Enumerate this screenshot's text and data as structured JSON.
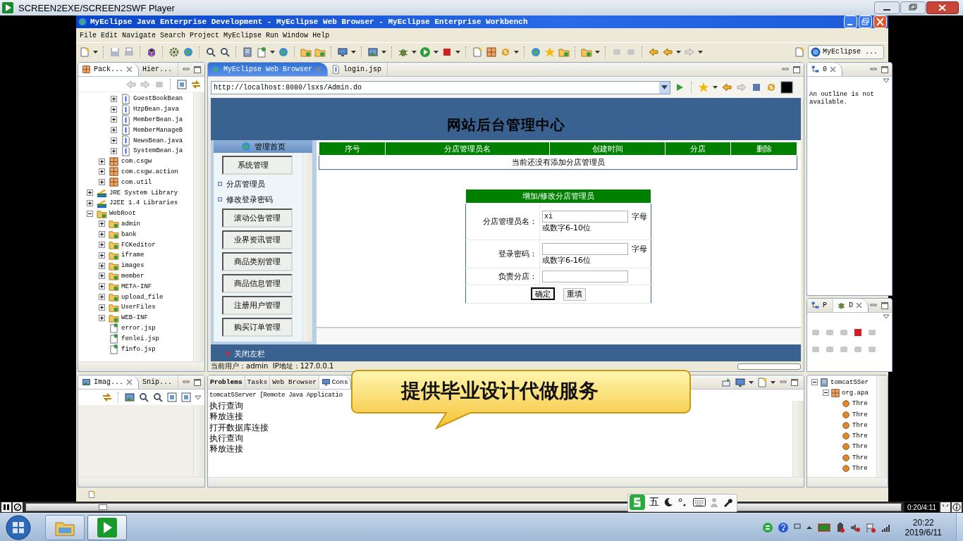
{
  "player": {
    "title": "SCREEN2EXE/SCREEN2SWF Player",
    "time": "0:20/4:11",
    "seek": {
      "level": 0.088
    }
  },
  "window": {
    "title": "MyEclipse Java Enterprise Development - MyEclipse Web Browser - MyEclipse Enterprise Workbench"
  },
  "menu": [
    "File",
    "Edit",
    "Navigate",
    "Search",
    "Project",
    "MyEclipse",
    "Run",
    "Window",
    "Help"
  ],
  "perspective": "MyEclipse ...",
  "left_tabs": [
    {
      "label": "Pack...",
      "selected": true
    },
    {
      "label": "Hier...",
      "selected": false
    }
  ],
  "tree": [
    {
      "children": [
        {
          "children": [
            {
              "label": "GuestBookBean",
              "kind": "java",
              "expanded": false
            },
            {
              "label": "HzpBean.java",
              "kind": "java",
              "expanded": false
            },
            {
              "label": "MemberBean.ja",
              "kind": "java",
              "expanded": false
            },
            {
              "label": "MemberManageB",
              "kind": "java",
              "expanded": false
            },
            {
              "label": "NewsBean.java",
              "kind": "java",
              "expanded": false
            },
            {
              "label": "SystemBean.ja",
              "kind": "java",
              "expanded": false
            }
          ]
        },
        {
          "label": "com.csgw",
          "kind": "package",
          "expanded": false
        },
        {
          "label": "com.csgw.action",
          "kind": "package",
          "expanded": false
        },
        {
          "label": "com.util",
          "kind": "package",
          "expanded": false
        }
      ]
    },
    {
      "label": "JRE System Library",
      "kind": "library",
      "expanded": false
    },
    {
      "label": "J2EE 1.4 Libraries",
      "kind": "library",
      "expanded": false
    },
    {
      "label": "WebRoot",
      "kind": "folder",
      "expanded": true,
      "children": [
        {
          "label": "admin",
          "kind": "folder",
          "expanded": false
        },
        {
          "label": "bank",
          "kind": "folder",
          "expanded": false
        },
        {
          "label": "FCKeditor",
          "kind": "folder",
          "expanded": false
        },
        {
          "label": "iframe",
          "kind": "folder",
          "expanded": false
        },
        {
          "label": "images",
          "kind": "folder",
          "expanded": false
        },
        {
          "label": "member",
          "kind": "folder",
          "expanded": false
        },
        {
          "label": "META-INF",
          "kind": "folder",
          "expanded": false
        },
        {
          "label": "upload_file",
          "kind": "folder",
          "expanded": false
        },
        {
          "label": "UserFiles",
          "kind": "folder",
          "expanded": false
        },
        {
          "label": "WEB-INF",
          "kind": "folder",
          "expanded": false
        },
        {
          "label": "error.jsp",
          "kind": "jsp"
        },
        {
          "label": "fenlei.jsp",
          "kind": "jsp"
        },
        {
          "label": "finfo.jsp",
          "kind": "jsp"
        }
      ]
    }
  ],
  "browser_tabs": [
    {
      "label": "MyEclipse Web Browser",
      "selected": true
    },
    {
      "label": "login.jsp",
      "selected": false
    }
  ],
  "url": "http://localhost:8080/lsxs/Admin.do",
  "page": {
    "header": "网站后台管理中心",
    "home": "管理首页",
    "nav": [
      {
        "label": "系统管理",
        "kind": "section"
      },
      {
        "label": "分店管理员",
        "kind": "link"
      },
      {
        "label": "修改登录密码",
        "kind": "link"
      },
      {
        "label": "滚动公告管理",
        "kind": "section"
      },
      {
        "label": "业界资讯管理",
        "kind": "section"
      },
      {
        "label": "商品类别管理",
        "kind": "section"
      },
      {
        "label": "商品信息管理",
        "kind": "section"
      },
      {
        "label": "注册用户管理",
        "kind": "section"
      },
      {
        "label": "购买订单管理",
        "kind": "section"
      }
    ],
    "table": {
      "columns": [
        "序号",
        "分店管理员名",
        "创建时间",
        "分店",
        "删除"
      ],
      "empty": "当前还没有添加分店管理员"
    },
    "form": {
      "title": "增加/修改分店管理员",
      "fields": [
        {
          "label": "分店管理员名：",
          "value": "xi",
          "note_1": "字母",
          "note_2": "或数字6-10位"
        },
        {
          "label": "登录密码：",
          "note_1": "字母",
          "note_2": "或数字6-16位"
        },
        {
          "label": "负责分店："
        }
      ],
      "buttons": [
        "确定",
        "重填"
      ]
    },
    "footer": "关闭左栏"
  },
  "browser_status": "当前用户：admin  IP地址：127.0.0.1",
  "page_progress": {
    "level": 0
  },
  "outline": {
    "tab": "0",
    "message": "An outline is not available."
  },
  "debug_tabs": [
    {
      "label": "P",
      "selected": false
    },
    {
      "label": "D",
      "selected": true
    }
  ],
  "image_tabs": [
    {
      "label": "Imag...",
      "selected": true
    },
    {
      "label": "Snip...",
      "selected": false
    }
  ],
  "console_tabs": [
    {
      "label": "Problems",
      "selected": false
    },
    {
      "label": "Tasks",
      "selected": false
    },
    {
      "label": "Web Browser",
      "selected": false
    },
    {
      "label": "Cons",
      "selected": true
    }
  ],
  "console": {
    "process": "tomcat5Server [Remote Java Applicatio",
    "lines": [
      "执行查询",
      "释放连接",
      "打开数据库连接",
      "执行查询",
      "释放连接"
    ]
  },
  "servers": {
    "root": "tomcat5Ser",
    "child": "org.apa",
    "threads": [
      "Thre",
      "Thre",
      "Thre",
      "Thre",
      "Thre",
      "Thre",
      "Thre"
    ]
  },
  "callout": "提供毕业设计代做服务",
  "ime": {
    "mode": "五"
  },
  "taskbar": {
    "time": "20:22",
    "date": "2019/6/11"
  }
}
